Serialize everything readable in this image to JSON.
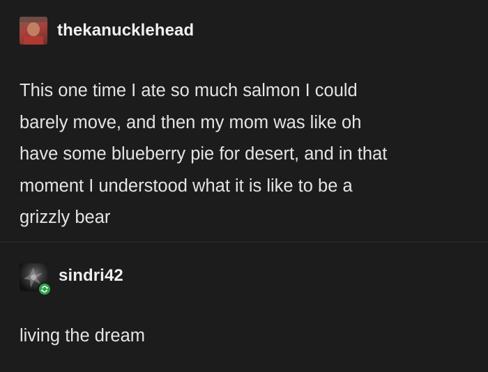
{
  "posts": [
    {
      "username": "thekanucklehead",
      "body_lines": [
        "This one time I ate so much salmon I could",
        "barely move, and then my mom was like oh",
        "have some blueberry pie for desert, and in that",
        "moment I understood what it is like to be a",
        "grizzly bear"
      ]
    },
    {
      "username": "sindri42",
      "reblog_badge_icon": "reblog-icon",
      "reblog_badge_color": "#2fa34a",
      "body_lines": [
        "living the dream"
      ]
    }
  ]
}
